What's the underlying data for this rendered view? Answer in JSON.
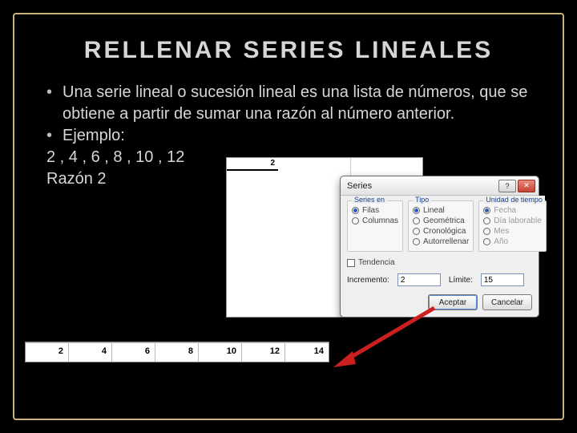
{
  "title": "RELLENAR SERIES LINEALES",
  "bullet1": "Una serie lineal o sucesión lineal es una lista de números, que se obtiene a partir de sumar una razón al número anterior.",
  "bullet2_label": "Ejemplo:",
  "example_series": "2 , 4 , 6 , 8 , 10 , 12",
  "example_ratio": "Razón 2",
  "sheet_top_value": "2",
  "dialog": {
    "title": "Series",
    "group_series_en": "Series en",
    "opt_filas": "Filas",
    "opt_columnas": "Columnas",
    "group_tipo": "Tipo",
    "opt_lineal": "Lineal",
    "opt_geometrica": "Geométrica",
    "opt_cronologica": "Cronológica",
    "opt_autorrellenar": "Autorrellenar",
    "group_unidad": "Unidad de tiempo",
    "opt_fecha": "Fecha",
    "opt_dia_lab": "Día laborable",
    "opt_mes": "Mes",
    "opt_ano": "Año",
    "chk_tendencia": "Tendencia",
    "lbl_incremento": "Incremento:",
    "val_incremento": "2",
    "lbl_limite": "Límite:",
    "val_limite": "15",
    "btn_aceptar": "Aceptar",
    "btn_cancelar": "Cancelar",
    "help_icon": "?",
    "close_icon": "✕"
  },
  "result_row": [
    "2",
    "4",
    "6",
    "8",
    "10",
    "12",
    "14"
  ]
}
